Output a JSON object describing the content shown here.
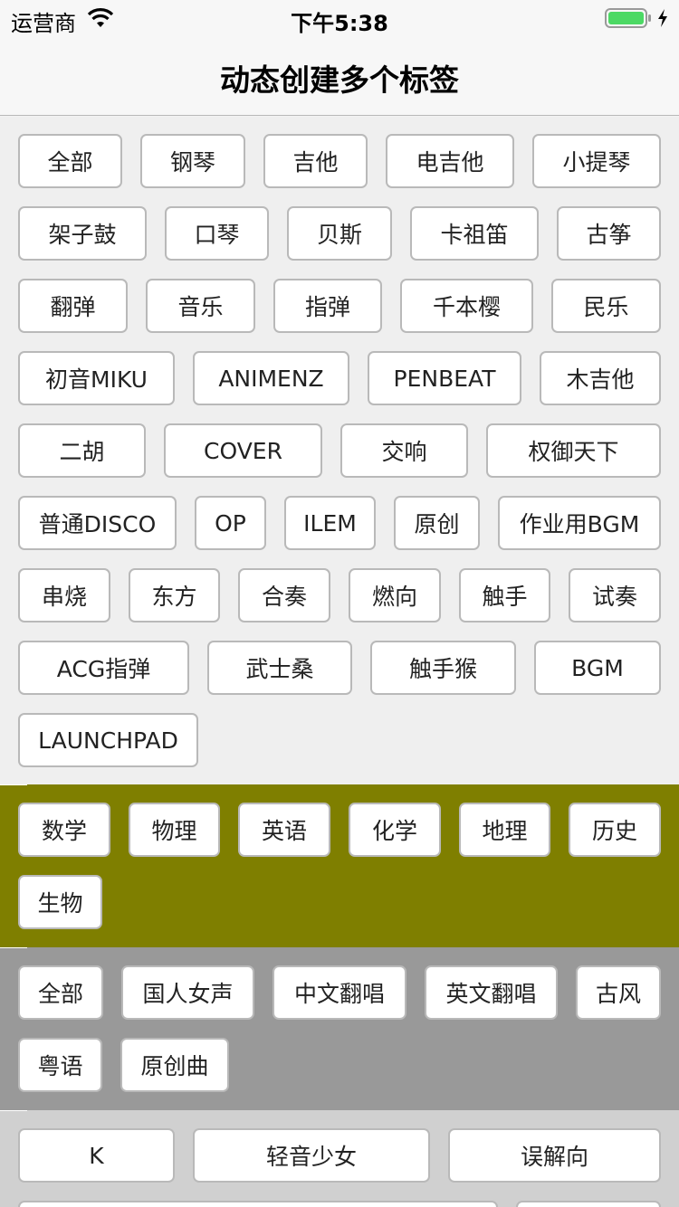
{
  "status_bar": {
    "carrier": "运营商",
    "time": "下午5:38",
    "battery_color": "#4cd964"
  },
  "nav": {
    "title": "动态创建多个标签"
  },
  "colors": {
    "section_1_bg": "#efefef",
    "section_2_bg": "#7f7f00",
    "section_3_bg": "#999999",
    "section_4_bg": "#d0d0d0"
  },
  "sections": [
    {
      "tags": [
        "全部",
        "钢琴",
        "吉他",
        "电吉他",
        "小提琴",
        "架子鼓",
        "口琴",
        "贝斯",
        "卡祖笛",
        "古筝",
        "翻弹",
        "音乐",
        "指弹",
        "千本樱",
        "民乐",
        "初音MIKU",
        "ANIMENZ",
        "PENBEAT",
        "木吉他",
        "二胡",
        "COVER",
        "交响",
        "权御天下",
        "普通DISCO",
        "OP",
        "ILEM",
        "原创",
        "作业用BGM",
        "串烧",
        "东方",
        "合奏",
        "燃向",
        "触手",
        "试奏",
        "ACG指弹",
        "武士桑",
        "触手猴",
        "BGM",
        "LAUNCHPAD"
      ]
    },
    {
      "tags": [
        "数学",
        "物理",
        "英语",
        "化学",
        "地理",
        "历史",
        "生物"
      ]
    },
    {
      "tags": [
        "全部",
        "国人女声",
        "中文翻唱",
        "英文翻唱",
        "古风",
        "粤语",
        "原创曲"
      ]
    },
    {
      "tags": [
        "K",
        "轻音少女",
        "误解向",
        "",
        ""
      ]
    }
  ]
}
